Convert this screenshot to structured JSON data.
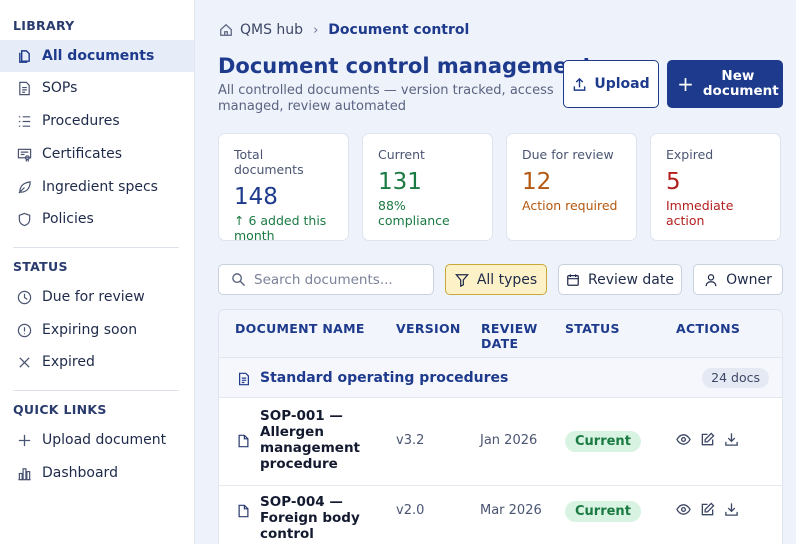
{
  "sidebar": {
    "library_heading": "LIBRARY",
    "library_items": [
      {
        "label": "All documents",
        "icon": "documents-icon"
      },
      {
        "label": "SOPs",
        "icon": "file-text-icon"
      },
      {
        "label": "Procedures",
        "icon": "list-icon"
      },
      {
        "label": "Certificates",
        "icon": "certificate-icon"
      },
      {
        "label": "Ingredient specs",
        "icon": "leaf-icon"
      },
      {
        "label": "Policies",
        "icon": "shield-icon"
      }
    ],
    "status_heading": "STATUS",
    "status_items": [
      {
        "label": "Due for review",
        "icon": "clock-icon"
      },
      {
        "label": "Expiring soon",
        "icon": "alert-circle-icon"
      },
      {
        "label": "Expired",
        "icon": "x-icon"
      }
    ],
    "quick_heading": "QUICK LINKS",
    "quick_items": [
      {
        "label": "Upload document",
        "icon": "plus-icon"
      },
      {
        "label": "Dashboard",
        "icon": "bar-chart-icon"
      }
    ]
  },
  "breadcrumb": {
    "root": "QMS hub",
    "current": "Document control"
  },
  "page": {
    "title": "Document control management",
    "subtitle": "All controlled documents — version tracked, access managed, review automated"
  },
  "buttons": {
    "upload": "Upload",
    "new_document": "New document"
  },
  "stats": [
    {
      "label": "Total documents",
      "value": "148",
      "note": "↑ 6 added this month",
      "color": "#1d3a8c",
      "note_color": "#1b7a42"
    },
    {
      "label": "Current",
      "value": "131",
      "note": "88% compliance",
      "color": "#1b7a42",
      "note_color": "#1b7a42"
    },
    {
      "label": "Due for review",
      "value": "12",
      "note": "Action required",
      "color": "#b4570f",
      "note_color": "#b4570f"
    },
    {
      "label": "Expired",
      "value": "5",
      "note": "Immediate action",
      "color": "#b32020",
      "note_color": "#b32020"
    }
  ],
  "filters": {
    "search_placeholder": "Search documents...",
    "all_types": "All types",
    "review_date": "Review date",
    "owner": "Owner"
  },
  "table": {
    "headers": [
      "DOCUMENT NAME",
      "VERSION",
      "REVIEW DATE",
      "STATUS",
      "ACTIONS"
    ],
    "group": {
      "label": "Standard operating procedures",
      "count": "24 docs"
    },
    "rows": [
      {
        "name": "SOP-001 — Allergen management procedure",
        "version": "v3.2",
        "review_date": "Jan 2026",
        "status": "Current"
      },
      {
        "name": "SOP-004 — Foreign body control",
        "version": "v2.0",
        "review_date": "Mar 2026",
        "status": "Current"
      }
    ]
  }
}
